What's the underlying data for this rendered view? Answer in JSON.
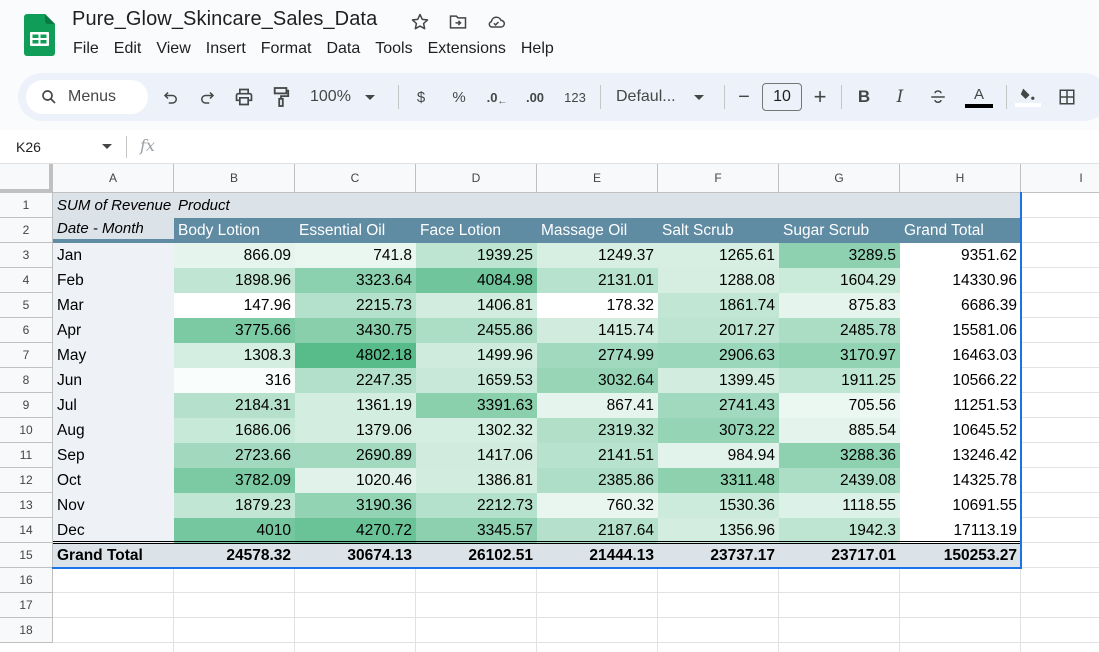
{
  "app": {
    "doc_title": "Pure_Glow_Skincare_Sales_Data",
    "title_icons": [
      "star-icon",
      "move-to-folder-icon",
      "cloud-saved-icon"
    ],
    "menu": [
      "File",
      "Edit",
      "View",
      "Insert",
      "Format",
      "Data",
      "Tools",
      "Extensions",
      "Help"
    ]
  },
  "toolbar": {
    "menus_label": "Menus",
    "zoom": "100%",
    "currency": "$",
    "percent": "%",
    "decrease_decimal": ".0",
    "increase_decimal": ".00",
    "number_format": "123",
    "font": "Defaul...",
    "font_size": "10",
    "minus": "−",
    "plus": "+",
    "bold": "B",
    "italic": "I",
    "text_color_letter": "A"
  },
  "formula_bar": {
    "name_box": "K26",
    "fx": "fx",
    "value": ""
  },
  "sheet": {
    "columns": [
      "A",
      "B",
      "C",
      "D",
      "E",
      "F",
      "G",
      "H",
      "I"
    ],
    "rows": [
      "1",
      "2",
      "3",
      "4",
      "5",
      "6",
      "7",
      "8",
      "9",
      "10",
      "11",
      "12",
      "13",
      "14",
      "15",
      "16",
      "17",
      "18"
    ],
    "pivot": {
      "value_label": "SUM of Revenue",
      "column_field": "Product",
      "row_field": "Date - Month",
      "headers": [
        "Body Lotion",
        "Essential Oil",
        "Face Lotion",
        "Massage Oil",
        "Salt Scrub",
        "Sugar Scrub",
        "Grand Total"
      ],
      "rows": [
        {
          "month": "Jan",
          "values": [
            "866.09",
            "741.8",
            "1939.25",
            "1249.37",
            "1265.61",
            "3289.5",
            "9351.62"
          ]
        },
        {
          "month": "Feb",
          "values": [
            "1898.96",
            "3323.64",
            "4084.98",
            "2131.01",
            "1288.08",
            "1604.29",
            "14330.96"
          ]
        },
        {
          "month": "Mar",
          "values": [
            "147.96",
            "2215.73",
            "1406.81",
            "178.32",
            "1861.74",
            "875.83",
            "6686.39"
          ]
        },
        {
          "month": "Apr",
          "values": [
            "3775.66",
            "3430.75",
            "2455.86",
            "1415.74",
            "2017.27",
            "2485.78",
            "15581.06"
          ]
        },
        {
          "month": "May",
          "values": [
            "1308.3",
            "4802.18",
            "1499.96",
            "2774.99",
            "2906.63",
            "3170.97",
            "16463.03"
          ]
        },
        {
          "month": "Jun",
          "values": [
            "316",
            "2247.35",
            "1659.53",
            "3032.64",
            "1399.45",
            "1911.25",
            "10566.22"
          ]
        },
        {
          "month": "Jul",
          "values": [
            "2184.31",
            "1361.19",
            "3391.63",
            "867.41",
            "2741.43",
            "705.56",
            "11251.53"
          ]
        },
        {
          "month": "Aug",
          "values": [
            "1686.06",
            "1379.06",
            "1302.32",
            "2319.32",
            "3073.22",
            "885.54",
            "10645.52"
          ]
        },
        {
          "month": "Sep",
          "values": [
            "2723.66",
            "2690.89",
            "1417.06",
            "2141.51",
            "984.94",
            "3288.36",
            "13246.42"
          ]
        },
        {
          "month": "Oct",
          "values": [
            "3782.09",
            "1020.46",
            "1386.81",
            "2385.86",
            "3311.48",
            "2439.08",
            "14325.78"
          ]
        },
        {
          "month": "Nov",
          "values": [
            "1879.23",
            "3190.36",
            "2212.73",
            "760.32",
            "1530.36",
            "1118.55",
            "10691.55"
          ]
        },
        {
          "month": "Dec",
          "values": [
            "4010",
            "4270.72",
            "3345.57",
            "2187.64",
            "1356.96",
            "1942.3",
            "17113.19"
          ]
        }
      ],
      "grand_total": {
        "label": "Grand Total",
        "values": [
          "24578.32",
          "30674.13",
          "26102.51",
          "21444.13",
          "23737.17",
          "23717.01",
          "150253.27"
        ]
      },
      "heatmap": {
        "min_value": 147.96,
        "max_value": 4802.18,
        "low_color": "#ffffff",
        "high_color": "#57bb8a"
      }
    }
  },
  "colors": {
    "header_bg": "#5f8ba3",
    "pivot_title_bg": "#dbe2e8",
    "selection": "#1a73e8",
    "sheets_green": "#0f9d58"
  }
}
